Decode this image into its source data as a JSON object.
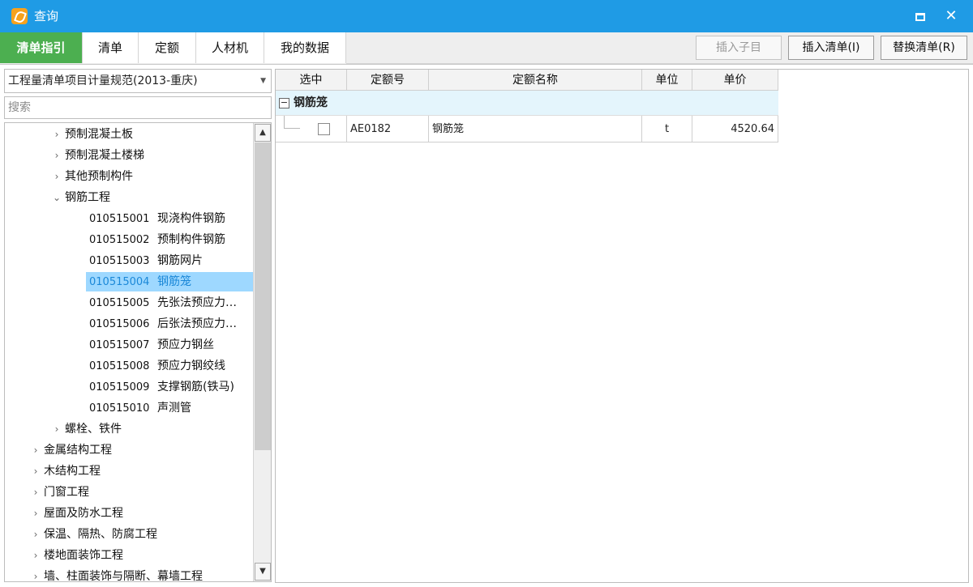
{
  "window": {
    "title": "查询",
    "icon": "app-logo-icon",
    "controls": {
      "maximize": "maximize-icon",
      "close": "✕"
    }
  },
  "tabs": [
    "清单指引",
    "清单",
    "定额",
    "人材机",
    "我的数据"
  ],
  "active_tab": "清单指引",
  "toolbar": {
    "insert_child": "插入子目",
    "insert_list": "插入清单(I)",
    "replace_list": "替换清单(R)"
  },
  "left": {
    "standard_value": "工程量清单项目计量规范(2013-重庆)",
    "search_placeholder": "搜索",
    "tree": [
      {
        "arrow": "›",
        "label": "预制混凝土板"
      },
      {
        "arrow": "›",
        "label": "预制混凝土楼梯"
      },
      {
        "arrow": "›",
        "label": "其他预制构件"
      },
      {
        "arrow": "⌄",
        "label": "钢筋工程"
      },
      {
        "code": "010515001",
        "label": "现浇构件钢筋"
      },
      {
        "code": "010515002",
        "label": "预制构件钢筋"
      },
      {
        "code": "010515003",
        "label": "钢筋网片"
      },
      {
        "code": "010515004",
        "label": "钢筋笼",
        "selected": true
      },
      {
        "code": "010515005",
        "label": "先张法预应力…"
      },
      {
        "code": "010515006",
        "label": "后张法预应力…"
      },
      {
        "code": "010515007",
        "label": "预应力钢丝"
      },
      {
        "code": "010515008",
        "label": "预应力钢绞线"
      },
      {
        "code": "010515009",
        "label": "支撑钢筋(铁马)"
      },
      {
        "code": "010515010",
        "label": "声测管"
      },
      {
        "arrow": "›",
        "label": "螺栓、铁件"
      },
      {
        "arrow": "›",
        "label": "金属结构工程"
      },
      {
        "arrow": "›",
        "label": "木结构工程"
      },
      {
        "arrow": "›",
        "label": "门窗工程"
      },
      {
        "arrow": "›",
        "label": "屋面及防水工程"
      },
      {
        "arrow": "›",
        "label": "保温、隔热、防腐工程"
      },
      {
        "arrow": "›",
        "label": "楼地面装饰工程"
      },
      {
        "arrow": "›",
        "label": "墙、柱面装饰与隔断、幕墙工程"
      }
    ]
  },
  "grid": {
    "columns": [
      "选中",
      "定额号",
      "定额名称",
      "单位",
      "单价"
    ],
    "group": {
      "toggle": "−",
      "label": "钢筋笼"
    },
    "rows": [
      {
        "code": "AE0182",
        "name": "钢筋笼",
        "unit": "t",
        "price": "4520.64"
      }
    ]
  },
  "colors": {
    "titlebar": "#1f9be5",
    "active_tab": "#4caf50",
    "selected_row": "#9ed8ff",
    "group_row": "#e4f5fc"
  }
}
